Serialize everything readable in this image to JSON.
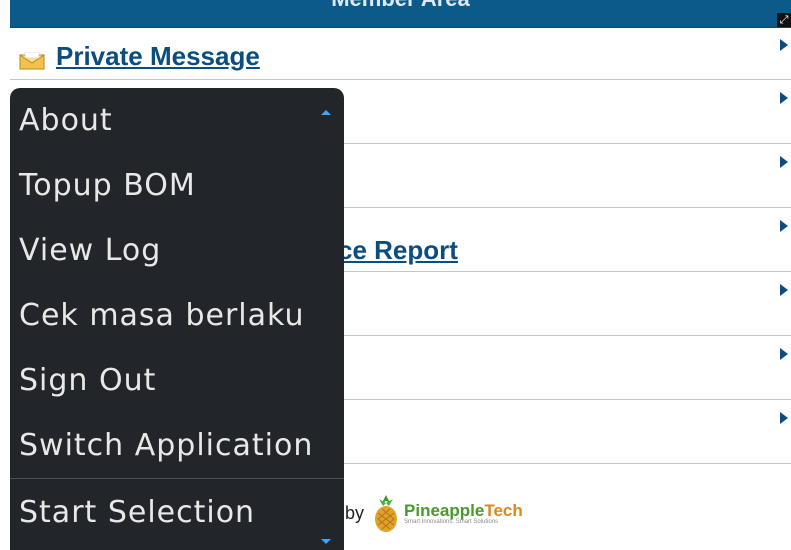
{
  "header": {
    "title": "Member Area"
  },
  "list": {
    "private_message_label": "Private Message",
    "report_label_visible": "ce Report"
  },
  "menu": {
    "items": [
      {
        "label": "About"
      },
      {
        "label": "Topup BOM"
      },
      {
        "label": "View Log"
      },
      {
        "label": "Cek masa berlaku"
      },
      {
        "label": "Sign Out"
      },
      {
        "label": "Switch Application"
      }
    ],
    "start_selection": "Start Selection"
  },
  "footer": {
    "by": "by",
    "brand_part1": "Pineapple",
    "brand_part2": "Tech",
    "tagline": "Smart Innovations. Smart Solutions"
  },
  "icons": {
    "envelope": "envelope-icon",
    "arrow": "chevron-right-icon",
    "corner": "resize-icon",
    "scroll_up": "scroll-up-icon",
    "scroll_down": "scroll-down-icon"
  },
  "colors": {
    "header": "#0b5a8a",
    "link": "#0b4d7e",
    "menu_bg": "#22262b",
    "menu_text": "#e8e8e8",
    "scroll_indicator": "#3da5ff"
  }
}
